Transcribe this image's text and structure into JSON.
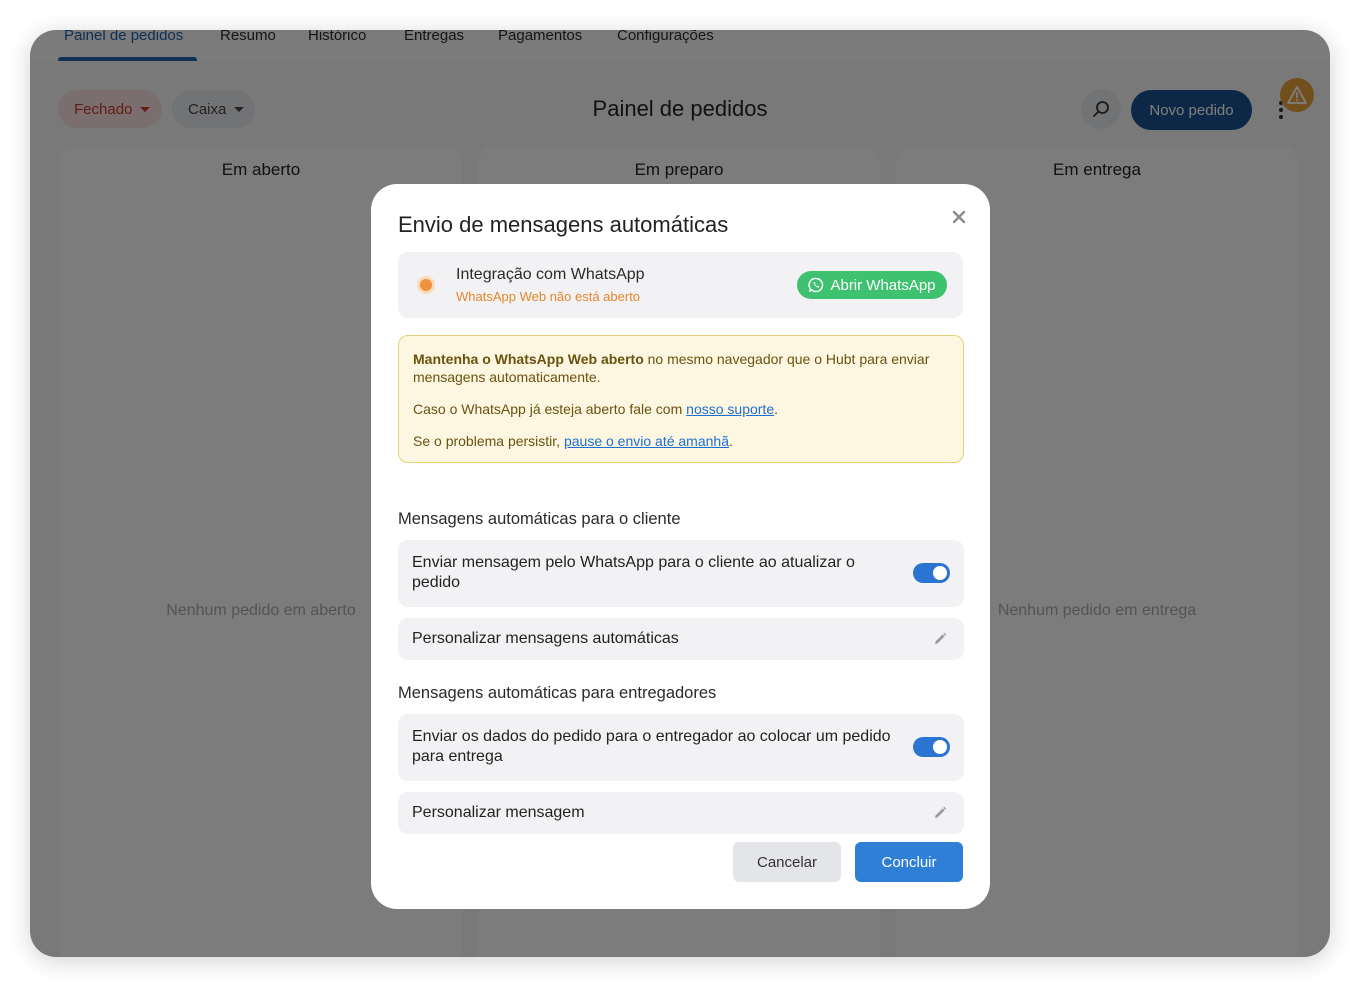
{
  "tabs": [
    "Painel de pedidos",
    "Resumo",
    "Histórico",
    "Entregas",
    "Pagamentos",
    "Configurações"
  ],
  "toolbar": {
    "status_filter": "Fechado",
    "register_filter": "Caixa",
    "page_title": "Painel de pedidos",
    "new_order_label": "Novo pedido"
  },
  "columns": [
    {
      "title": "Em aberto",
      "empty": "Nenhum pedido em aberto"
    },
    {
      "title": "Em preparo",
      "empty": ""
    },
    {
      "title": "Em entrega",
      "empty": "Nenhum pedido em entrega"
    }
  ],
  "modal": {
    "title": "Envio de mensagens automáticas",
    "whatsapp": {
      "title": "Integração com WhatsApp",
      "status": "WhatsApp Web não está aberto",
      "open_button": "Abrir WhatsApp"
    },
    "notice": {
      "line1_bold": "Mantenha o WhatsApp Web aberto",
      "line1_rest": " no mesmo navegador que o Hubt para enviar mensagens automaticamente.",
      "line2_text": "Caso o WhatsApp já esteja aberto fale com ",
      "line2_link": "nosso suporte",
      "line2_end": ".",
      "line3_text": "Se o problema persistir, ",
      "line3_link": "pause o envio até amanhã",
      "line3_end": "."
    },
    "customer_section": {
      "title": "Mensagens automáticas para o cliente",
      "toggle_label": "Enviar mensagem pelo WhatsApp para o cliente ao atualizar o pedido",
      "toggle_on": true,
      "customize_label": "Personalizar mensagens automáticas"
    },
    "courier_section": {
      "title": "Mensagens automáticas para entregadores",
      "toggle_label": "Enviar os dados do pedido para o entregador ao colocar um pedido para entrega",
      "toggle_on": true,
      "customize_label": "Personalizar mensagem"
    },
    "cancel_label": "Cancelar",
    "confirm_label": "Concluir"
  },
  "colors": {
    "primary": "#2f7fd6",
    "navy": "#1a4f8c",
    "whatsapp_green": "#3fc26f",
    "warning_orange": "#f0923e"
  }
}
